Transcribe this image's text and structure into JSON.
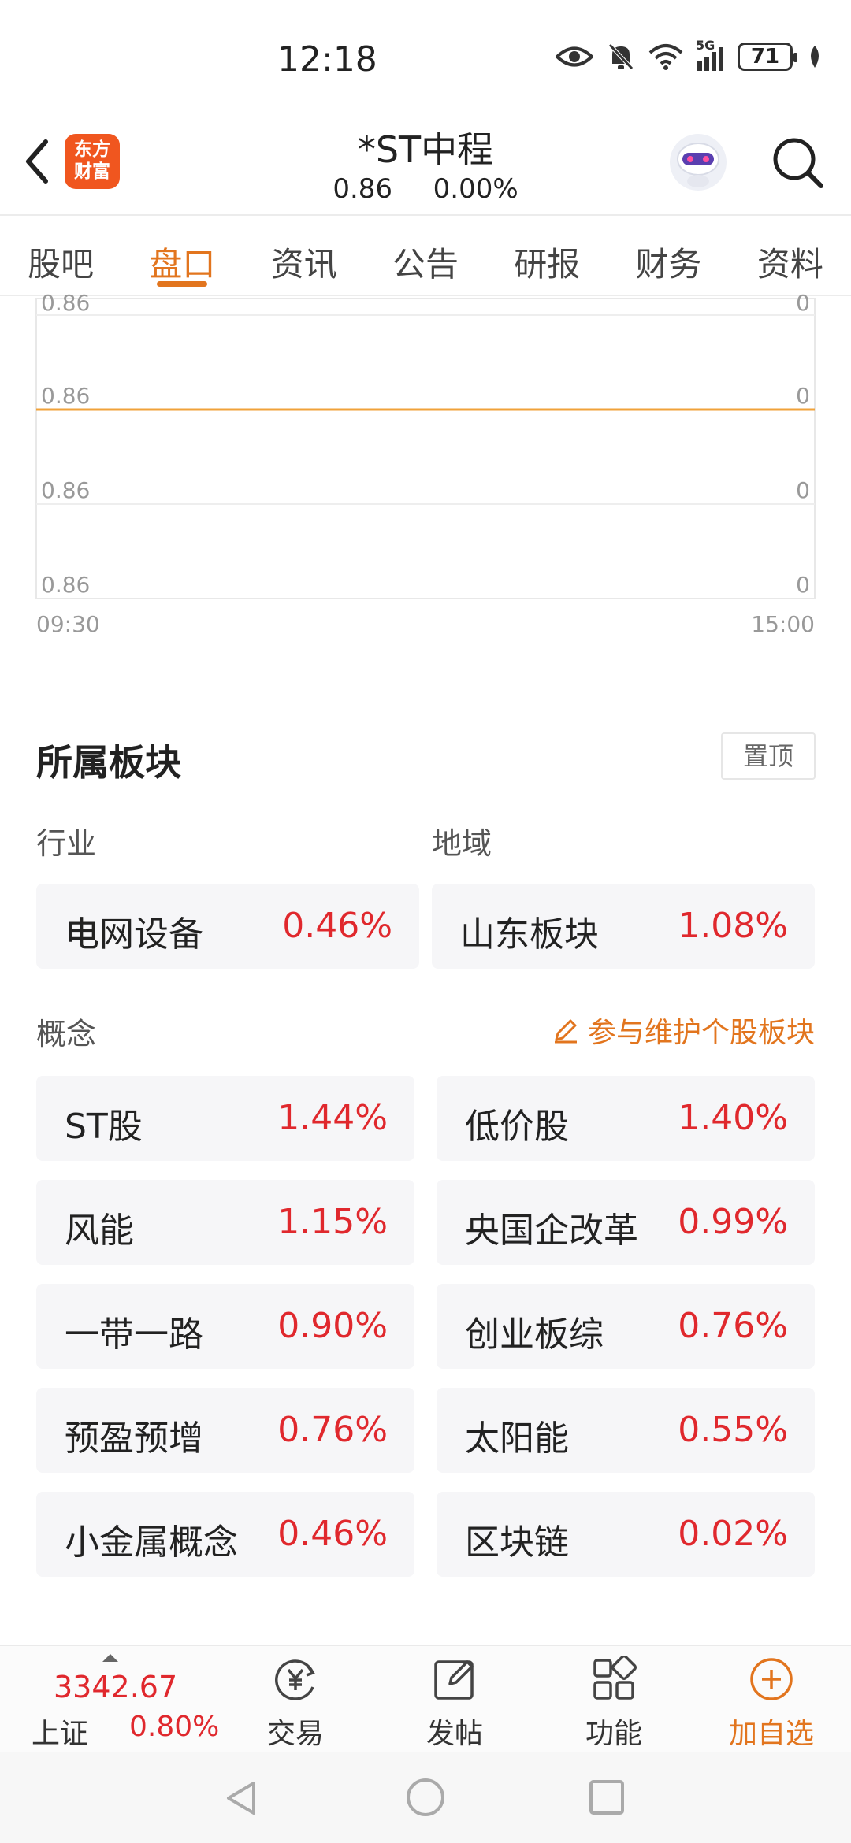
{
  "status_bar": {
    "time": "12:18",
    "network": "5G",
    "battery": "71"
  },
  "header": {
    "logo_text_line1": "东方",
    "logo_text_line2": "财富",
    "stock_name": "*ST中程",
    "price": "0.86",
    "change_pct": "0.00%"
  },
  "tabs": [
    {
      "label": "股吧",
      "active": false
    },
    {
      "label": "盘口",
      "active": true
    },
    {
      "label": "资讯",
      "active": false
    },
    {
      "label": "公告",
      "active": false
    },
    {
      "label": "研报",
      "active": false
    },
    {
      "label": "财务",
      "active": false
    },
    {
      "label": "资料",
      "active": false
    }
  ],
  "chart_data": {
    "type": "line",
    "title": "",
    "x_start_label": "09:30",
    "x_end_label": "15:00",
    "left_axis_ticks": [
      "0.86",
      "0.86",
      "0.86",
      "0.86"
    ],
    "right_axis_ticks": [
      "0",
      "0",
      "0",
      "0"
    ],
    "series": [
      {
        "values": [
          0.86,
          0.86
        ]
      }
    ],
    "line_color": "#f0a23a"
  },
  "sectors": {
    "title": "所属板块",
    "pin_label": "置顶",
    "industry_label": "行业",
    "region_label": "地域",
    "industry": {
      "name": "电网设备",
      "pct": "0.46%"
    },
    "region": {
      "name": "山东板块",
      "pct": "1.08%"
    },
    "concept_label": "概念",
    "maintain_link": "参与维护个股板块",
    "concepts": [
      {
        "name": "ST股",
        "pct": "1.44%"
      },
      {
        "name": "低价股",
        "pct": "1.40%"
      },
      {
        "name": "风能",
        "pct": "1.15%"
      },
      {
        "name": "央国企改革",
        "pct": "0.99%"
      },
      {
        "name": "一带一路",
        "pct": "0.90%"
      },
      {
        "name": "创业板综",
        "pct": "0.76%"
      },
      {
        "name": "预盈预增",
        "pct": "0.76%"
      },
      {
        "name": "太阳能",
        "pct": "0.55%"
      },
      {
        "name": "小金属概念",
        "pct": "0.46%"
      },
      {
        "name": "区块链",
        "pct": "0.02%"
      }
    ]
  },
  "bottom_bar": {
    "index_value": "3342.67",
    "index_name": "上证",
    "index_pct": "0.80%",
    "trade_label": "交易",
    "post_label": "发帖",
    "function_label": "功能",
    "add_watch_label": "加自选"
  },
  "colors": {
    "accent": "#e2751e",
    "up": "#e0282d",
    "card_bg": "#f6f6f8"
  }
}
